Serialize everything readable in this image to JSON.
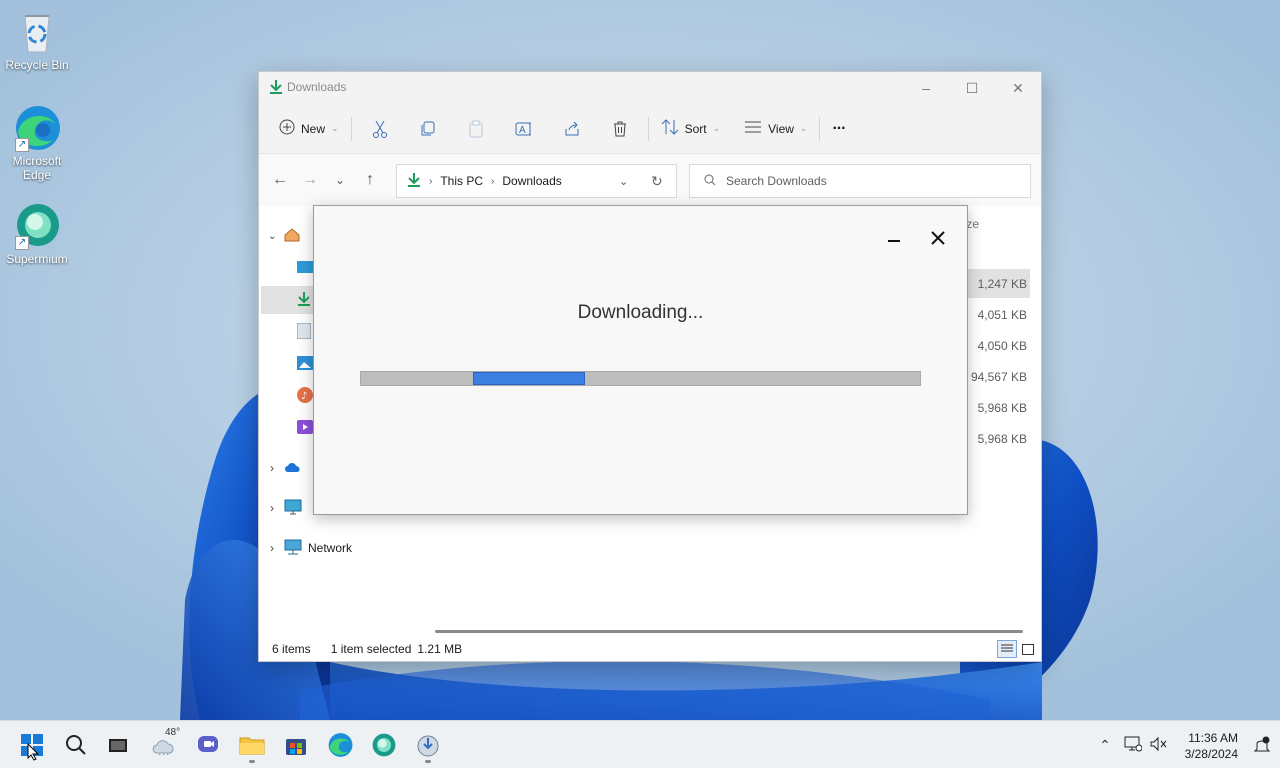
{
  "desktop": {
    "icons": [
      {
        "label": "Recycle Bin"
      },
      {
        "label": "Microsoft Edge"
      },
      {
        "label": "Supermium"
      }
    ]
  },
  "explorer": {
    "title": "Downloads",
    "toolbar": {
      "new_label": "New",
      "sort_label": "Sort",
      "view_label": "View",
      "more_label": "···"
    },
    "address": {
      "crumbs": [
        "This PC",
        "Downloads"
      ],
      "search_placeholder": "Search Downloads"
    },
    "column_size_header": "ze",
    "sizes": [
      "1,247 KB",
      "4,051 KB",
      "4,050 KB",
      "94,567 KB",
      "5,968 KB",
      "5,968 KB"
    ],
    "navpane": {
      "network_label": "Network"
    },
    "status": {
      "items": "6 items",
      "selected": "1 item selected",
      "selected_size": "1.21 MB"
    }
  },
  "dialog": {
    "message": "Downloading...",
    "progress": {
      "start_fraction": 0.2,
      "end_fraction": 0.4
    }
  },
  "taskbar": {
    "weather_temp": "48°",
    "time": "11:36 AM",
    "date": "3/28/2024"
  },
  "colors": {
    "accent": "#0067c0",
    "progress_fill": "#3d7fe0",
    "download_green": "#1e9c5a"
  }
}
